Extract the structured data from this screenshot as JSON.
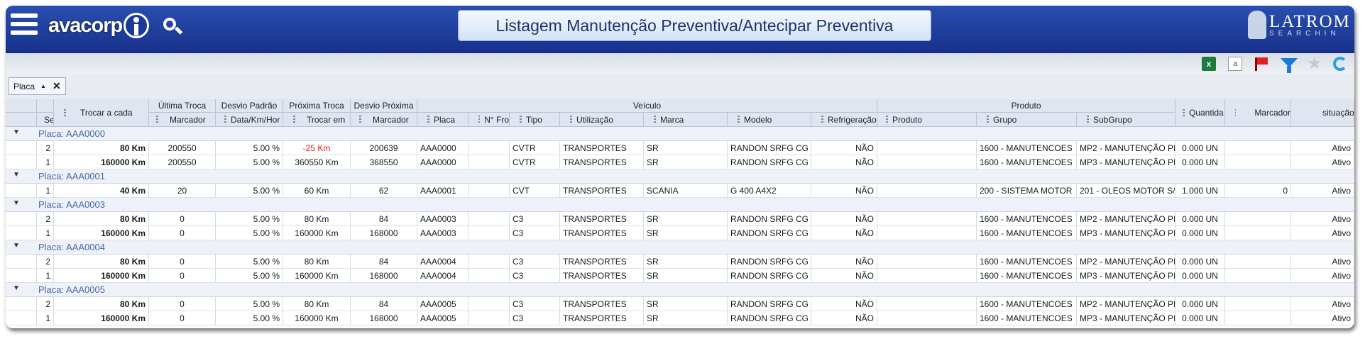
{
  "header": {
    "logo_text": "avacorp",
    "page_title": "Listagem Manutenção Preventiva/Antecipar Preventiva",
    "brand_name": "LATROM",
    "brand_sub": "SEARCHIN"
  },
  "toolbar": {
    "icons": [
      "excel-icon",
      "text-export-icon",
      "flag-icon",
      "filter-icon",
      "star-icon",
      "refresh-icon"
    ]
  },
  "grouping": {
    "chip_label": "Placa"
  },
  "columns": {
    "groups": {
      "ultima_troca": "Última Troca",
      "desvio_padrao": "Desvio Padrão",
      "proxima_troca": "Próxima Troca",
      "desvio_proxima": "Desvio Próxima",
      "veiculo": "Veículo",
      "produto": "Produto"
    },
    "seq": "Se",
    "trocar_a_cada": "Trocar a cada",
    "marcador_ultima": "Marcador",
    "data_km_hor": "Data/Km/Hor",
    "trocar_em": "Trocar em",
    "marcador_proxima": "Marcador",
    "placa": "Placa",
    "nro_frota": "N° Fro",
    "tipo": "Tipo",
    "utilizacao": "Utilização",
    "marca": "Marca",
    "modelo": "Modelo",
    "refrigeracao": "Refrigeração",
    "produto": "Produto",
    "grupo": "Grupo",
    "subgrupo": "SubGrupo",
    "quantidade": "Quantida",
    "marcador": "Marcador",
    "situacao": "situação"
  },
  "groups": [
    {
      "label": "Placa: AAA0000",
      "rows": [
        {
          "seq": "2",
          "trocar": "80 Km",
          "marc_ult": "200550",
          "desvio": "5.00 %",
          "trocar_em": "-25 Km",
          "trocar_em_alert": true,
          "marc_prox": "200639",
          "placa": "AAA0000",
          "frota": "",
          "tipo": "CVTR",
          "util": "TRANSPORTES",
          "marca": "SR",
          "modelo": "RANDON SRFG CG",
          "refrig": "NÃO",
          "produto": "",
          "grupo": "1600 - MANUTENCOES",
          "subgrupo": "MP2 - MANUTENÇÃO PI",
          "qtd": "0.000 UN",
          "marcador": "",
          "situacao": "Ativo"
        },
        {
          "seq": "1",
          "trocar": "160000 Km",
          "marc_ult": "200550",
          "desvio": "5.00 %",
          "trocar_em": "360550 Km",
          "marc_prox": "368550",
          "placa": "AAA0000",
          "frota": "",
          "tipo": "CVTR",
          "util": "TRANSPORTES",
          "marca": "SR",
          "modelo": "RANDON SRFG CG",
          "refrig": "NÃO",
          "produto": "",
          "grupo": "1600 - MANUTENCOES",
          "subgrupo": "MP3 - MANUTENÇÃO PI",
          "qtd": "0.000 UN",
          "marcador": "",
          "situacao": "Ativo"
        }
      ]
    },
    {
      "label": "Placa: AAA0001",
      "rows": [
        {
          "seq": "1",
          "trocar": "40 Km",
          "marc_ult": "20",
          "desvio": "5.00 %",
          "trocar_em": "60 Km",
          "marc_prox": "62",
          "placa": "AAA0001",
          "frota": "",
          "tipo": "CVT",
          "util": "TRANSPORTES",
          "marca": "SCANIA",
          "modelo": "G 400 A4X2",
          "refrig": "NÃO",
          "produto": "",
          "grupo": "200 - SISTEMA MOTOR",
          "subgrupo": "201 - OLEOS MOTOR S/",
          "qtd": "1.000 UN",
          "marcador": "0",
          "situacao": "Ativo"
        }
      ]
    },
    {
      "label": "Placa: AAA0003",
      "rows": [
        {
          "seq": "2",
          "trocar": "80 Km",
          "marc_ult": "0",
          "desvio": "5.00 %",
          "trocar_em": "80 Km",
          "marc_prox": "84",
          "placa": "AAA0003",
          "frota": "",
          "tipo": "C3",
          "util": "TRANSPORTES",
          "marca": "SR",
          "modelo": "RANDON SRFG CG",
          "refrig": "NÃO",
          "produto": "",
          "grupo": "1600 - MANUTENCOES",
          "subgrupo": "MP2 - MANUTENÇÃO PI",
          "qtd": "0.000 UN",
          "marcador": "",
          "situacao": "Ativo"
        },
        {
          "seq": "1",
          "trocar": "160000 Km",
          "marc_ult": "0",
          "desvio": "5.00 %",
          "trocar_em": "160000 Km",
          "marc_prox": "168000",
          "placa": "AAA0003",
          "frota": "",
          "tipo": "C3",
          "util": "TRANSPORTES",
          "marca": "SR",
          "modelo": "RANDON SRFG CG",
          "refrig": "NÃO",
          "produto": "",
          "grupo": "1600 - MANUTENCOES",
          "subgrupo": "MP3 - MANUTENÇÃO PI",
          "qtd": "0.000 UN",
          "marcador": "",
          "situacao": "Ativo"
        }
      ]
    },
    {
      "label": "Placa: AAA0004",
      "rows": [
        {
          "seq": "2",
          "trocar": "80 Km",
          "marc_ult": "0",
          "desvio": "5.00 %",
          "trocar_em": "80 Km",
          "marc_prox": "84",
          "placa": "AAA0004",
          "frota": "",
          "tipo": "C3",
          "util": "TRANSPORTES",
          "marca": "SR",
          "modelo": "RANDON SRFG CG",
          "refrig": "NÃO",
          "produto": "",
          "grupo": "1600 - MANUTENCOES",
          "subgrupo": "MP2 - MANUTENÇÃO PI",
          "qtd": "0.000 UN",
          "marcador": "",
          "situacao": "Ativo"
        },
        {
          "seq": "1",
          "trocar": "160000 Km",
          "marc_ult": "0",
          "desvio": "5.00 %",
          "trocar_em": "160000 Km",
          "marc_prox": "168000",
          "placa": "AAA0004",
          "frota": "",
          "tipo": "C3",
          "util": "TRANSPORTES",
          "marca": "SR",
          "modelo": "RANDON SRFG CG",
          "refrig": "NÃO",
          "produto": "",
          "grupo": "1600 - MANUTENCOES",
          "subgrupo": "MP3 - MANUTENÇÃO PI",
          "qtd": "0.000 UN",
          "marcador": "",
          "situacao": "Ativo"
        }
      ]
    },
    {
      "label": "Placa: AAA0005",
      "rows": [
        {
          "seq": "2",
          "trocar": "80 Km",
          "marc_ult": "0",
          "desvio": "5.00 %",
          "trocar_em": "80 Km",
          "marc_prox": "84",
          "placa": "AAA0005",
          "frota": "",
          "tipo": "C3",
          "util": "TRANSPORTES",
          "marca": "SR",
          "modelo": "RANDON SRFG CG",
          "refrig": "NÃO",
          "produto": "",
          "grupo": "1600 - MANUTENCOES",
          "subgrupo": "MP2 - MANUTENÇÃO PI",
          "qtd": "0.000 UN",
          "marcador": "",
          "situacao": "Ativo"
        },
        {
          "seq": "1",
          "trocar": "160000 Km",
          "marc_ult": "0",
          "desvio": "5.00 %",
          "trocar_em": "160000 Km",
          "marc_prox": "168000",
          "placa": "AAA0005",
          "frota": "",
          "tipo": "C3",
          "util": "TRANSPORTES",
          "marca": "SR",
          "modelo": "RANDON SRFG CG",
          "refrig": "NÃO",
          "produto": "",
          "grupo": "1600 - MANUTENCOES",
          "subgrupo": "MP3 - MANUTENÇÃO PI",
          "qtd": "0.000 UN",
          "marcador": "",
          "situacao": "Ativo"
        }
      ]
    }
  ]
}
